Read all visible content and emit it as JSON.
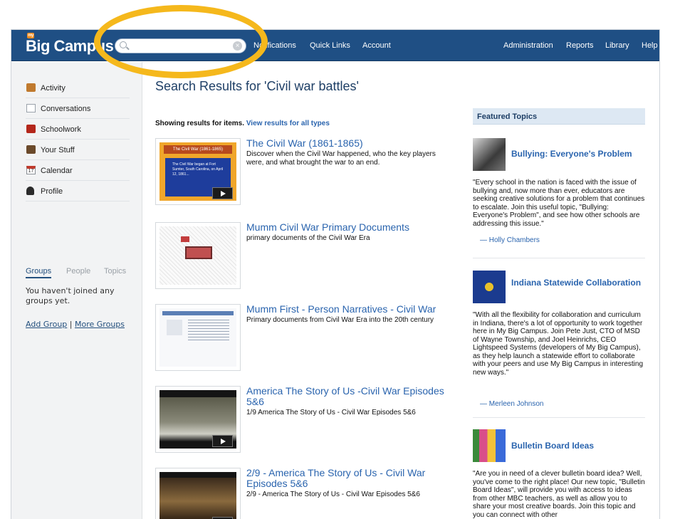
{
  "brand": {
    "logo_badge": "my",
    "logo_text": "Big Campus"
  },
  "search": {
    "value": "",
    "placeholder": ""
  },
  "topnav": {
    "left": [
      "Notifications",
      "Quick Links",
      "Account"
    ],
    "right": [
      "Administration",
      "Reports",
      "Library",
      "Help"
    ]
  },
  "sidebar": {
    "items": [
      {
        "label": "Activity",
        "icon": "activity-icon"
      },
      {
        "label": "Conversations",
        "icon": "envelope-icon"
      },
      {
        "label": "Schoolwork",
        "icon": "schoolwork-icon"
      },
      {
        "label": "Your Stuff",
        "icon": "briefcase-icon"
      },
      {
        "label": "Calendar",
        "icon": "calendar-icon",
        "icon_text": "17"
      },
      {
        "label": "Profile",
        "icon": "person-icon"
      }
    ],
    "tabs": [
      "Groups",
      "People",
      "Topics"
    ],
    "empty_message": "You haven't joined any groups yet.",
    "links": {
      "add": "Add Group",
      "separator": "|",
      "more": "More Groups"
    }
  },
  "main": {
    "title": "Search Results for 'Civil war battles'",
    "showing_text": "Showing results for items.",
    "showing_link": "View results for all types",
    "results": [
      {
        "title": "The Civil War (1861-1865)",
        "description": "Discover when the Civil War happened, who the key players were, and what brought the war to an end.",
        "thumb_caption": "The Civil War (1861-1865)",
        "thumb_text": "The Civil War began at Fort Sumter, South Carolina, on April 12, 1861...",
        "has_play": true
      },
      {
        "title": "Mumm Civil War Primary Documents",
        "description": "primary documents of the Civil War Era",
        "has_play": false
      },
      {
        "title": "Mumm First - Person Narratives - Civil War",
        "description": "Primary documents from Civil War Era into the 20th century",
        "has_play": false
      },
      {
        "title": "America The Story of Us -Civil War Episodes 5&6",
        "description": "1/9 America The Story of Us - Civil War Episodes 5&6",
        "has_play": true
      },
      {
        "title": "2/9 - America The Story of Us - Civil War Episodes 5&6",
        "description": "2/9 - America The Story of Us - Civil War Episodes 5&6",
        "has_play": true
      }
    ]
  },
  "featured": {
    "header": "Featured Topics",
    "topics": [
      {
        "title": "Bullying: Everyone's Problem",
        "quote": "\"Every school in the nation is faced with the issue of bullying and, now more than ever, educators are seeking creative solutions for a problem that continues to escalate. Join this useful topic, \"Bullying: Everyone's Problem\", and see how other schools are addressing this issue.\"",
        "author": "— Holly Chambers"
      },
      {
        "title": "Indiana Statewide Collaboration",
        "quote": "\"With all the flexibility for collaboration and curriculum in Indiana, there's a lot of opportunity to work together here in My Big Campus. Join Pete Just, CTO of MSD of Wayne Township, and Joel Heinrichs, CEO Lightspeed Systems (developers of My Big Campus), as they help launch a statewide effort to collaborate with your peers and use My Big Campus in interesting new ways.\"",
        "author": "— Merleen Johnson"
      },
      {
        "title": "Bulletin Board Ideas",
        "quote": "\"Are you in need of a clever bulletin board idea? Well, you've come to the right place! Our new topic, \"Bulletin Board Ideas\", will provide you with access to ideas from other MBC teachers, as well as allow you to share your most creative boards. Join this topic and you can connect with other",
        "author": ""
      }
    ]
  },
  "colors": {
    "navbar": "#1f4f84",
    "link": "#2a64ae",
    "highlight": "#f5b81c"
  }
}
